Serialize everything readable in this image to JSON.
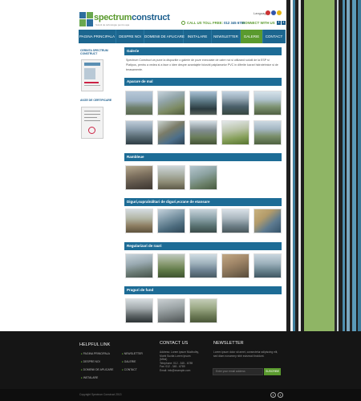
{
  "header": {
    "logo_text_a": "spectrum",
    "logo_text_b": "construct",
    "logo_tagline": "Solutii de tehnologie pentru apa",
    "language_label": "Language",
    "call_label": "CALL US TOLL FREE:",
    "phone": "012 345 6789",
    "connect_label": "CONNECT WITH US"
  },
  "nav": {
    "items": [
      {
        "label": "PAGINA PRINCIPALA"
      },
      {
        "label": "DESPRE NOI"
      },
      {
        "label": "DOMENII DE APLICARE"
      },
      {
        "label": "INSTALARE"
      },
      {
        "label": "NEWSLETTER"
      },
      {
        "label": "GALERIE"
      },
      {
        "label": "CONTACT"
      }
    ]
  },
  "sidebar": {
    "cert1_label": "CERINTA SPECTRUM CONSTRUCT",
    "cert2_label": "AVIZE DE CERTIFICARE"
  },
  "main": {
    "gallery_title": "Galerie",
    "intro": "Spectrum Construct va pune la dispozitie o galerie de poze executate de catre noi si utilizand solutii de la ESP si Platipus, pentru a vedea si a face o idee despre avantajele folosirii palplanselor PVC in diferite lucrari hidrotehnice si de terasamente.",
    "sections": [
      {
        "title": "Aparare de mal"
      },
      {
        "title": "Rambleue"
      },
      {
        "title": "Diguri,supraînăltari de diguri,ecrane de etansare"
      },
      {
        "title": "Regularizari de rauri"
      },
      {
        "title": "Praguri de fund"
      }
    ]
  },
  "footer": {
    "helpful_title": "HELPFUL LINK",
    "links_col1": [
      "PAGINA PRINCIPALA",
      "DESPRE NOI",
      "DOMENII DE APLICARE",
      "INSTALARE"
    ],
    "links_col2": [
      "NEWSLETTER",
      "GALERIE",
      "CONTACT"
    ],
    "contact_title": "CONTACT US",
    "contact_lines": [
      "Address: Lorem ipsum Mudholby,",
      "Morbi Sucita Lorem Ipsum",
      "(Mlnd)",
      "Telephone: 012 - 345 - 6789",
      "Fax: 012 - 345 - 6789",
      "Email: info@example.com"
    ],
    "newsletter_title": "NEWSLETTER",
    "newsletter_text": [
      "Lorem ipsum dolor sit amet, consectetur adipiscing elit,",
      "sed diam nonummy nibh euismod tincidunt."
    ],
    "email_placeholder": "Enter your email address",
    "subscribe_label": "SUSCRIBE",
    "copyright": "Copyright Spectrum Construct 2013"
  },
  "colors": {
    "nav_blue": "#1c668f",
    "accent_green": "#5a9a2e",
    "footer_bg": "#151515"
  }
}
